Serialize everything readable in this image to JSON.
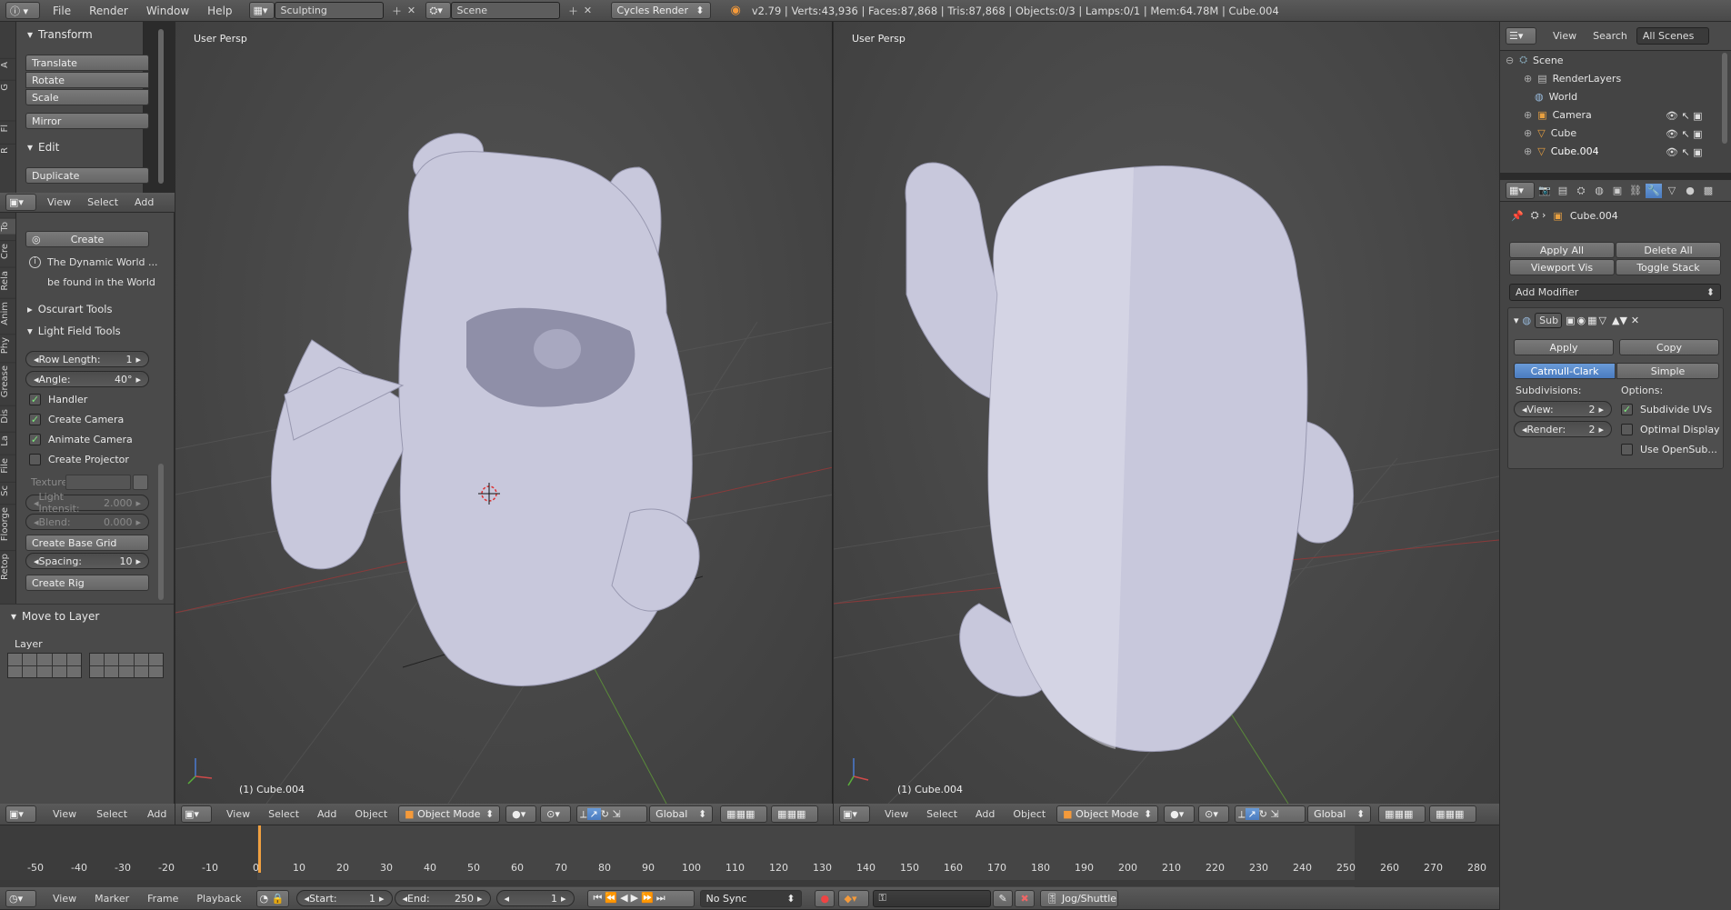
{
  "topbar": {
    "menus": [
      "File",
      "Render",
      "Window",
      "Help"
    ],
    "screen_layout": "Sculpting",
    "scene": "Scene",
    "render_engine": "Cycles Render",
    "stats": "v2.79 | Verts:43,936 | Faces:87,868 | Tris:87,868 | Objects:0/3 | Lamps:0/1 | Mem:64.78M | Cube.004"
  },
  "toolshelf_top": {
    "transform_title": "Transform",
    "transform_buttons": [
      "Translate",
      "Rotate",
      "Scale"
    ],
    "mirror": "Mirror",
    "edit_title": "Edit",
    "duplicate": "Duplicate",
    "tabs": [
      "A",
      "G",
      "Fl",
      "R"
    ],
    "header_menus": [
      "View",
      "Select",
      "Add"
    ]
  },
  "toolshelf_bottom": {
    "create": "Create",
    "info_line1": "The Dynamic World ...",
    "info_line2": "be found in the World",
    "oscurart": "Oscurart Tools",
    "lightfield": "Light Field Tools",
    "row_length_label": "Row Length:",
    "row_length_value": "1",
    "angle_label": "Angle:",
    "angle_value": "40°",
    "handler": "Handler",
    "create_camera": "Create Camera",
    "animate_camera": "Animate Camera",
    "create_projector": "Create Projector",
    "texture_label": "Texture",
    "light_intensity_label": "Light Intensit:",
    "light_intensity_value": "2.000",
    "blend_label": "Blend:",
    "blend_value": "0.000",
    "create_base_grid": "Create Base Grid",
    "spacing_label": "Spacing:",
    "spacing_value": "10",
    "create_rig": "Create Rig",
    "move_to_layer": "Move to Layer",
    "layer_label": "Layer",
    "tabs": [
      "To",
      "Cre",
      "Rela",
      "Anim",
      "Phy",
      "Grease",
      "Dis",
      "La",
      "File",
      "Sc",
      "Floorge",
      "Retop"
    ],
    "header_menus": [
      "View",
      "Select",
      "Add"
    ]
  },
  "viewport_left": {
    "label": "User Persp",
    "object_label": "(1) Cube.004",
    "menus": [
      "View",
      "Select",
      "Add",
      "Object"
    ],
    "mode": "Object Mode",
    "orientation": "Global"
  },
  "viewport_right": {
    "label": "User Persp",
    "object_label": "(1) Cube.004",
    "menus": [
      "View",
      "Select",
      "Add",
      "Object"
    ],
    "mode": "Object Mode",
    "orientation": "Global"
  },
  "timeline": {
    "ticks": [
      "-50",
      "-40",
      "-30",
      "-20",
      "-10",
      "0",
      "10",
      "20",
      "30",
      "40",
      "50",
      "60",
      "70",
      "80",
      "90",
      "100",
      "110",
      "120",
      "130",
      "140",
      "150",
      "160",
      "170",
      "180",
      "190",
      "200",
      "210",
      "220",
      "230",
      "240",
      "250",
      "260",
      "270",
      "280"
    ],
    "menus": [
      "View",
      "Marker",
      "Frame",
      "Playback"
    ],
    "start_label": "Start:",
    "start_value": "1",
    "end_label": "End:",
    "end_value": "250",
    "current_frame": "1",
    "sync": "No Sync",
    "jog": "Jog/Shuttle"
  },
  "outliner": {
    "menus": [
      "View",
      "Search"
    ],
    "filter": "All Scenes",
    "items": [
      "Scene",
      "RenderLayers",
      "World",
      "Camera",
      "Cube",
      "Cube.004"
    ]
  },
  "properties": {
    "object_name": "Cube.004",
    "apply_all": "Apply All",
    "delete_all": "Delete All",
    "viewport_vis": "Viewport Vis",
    "toggle_stack": "Toggle Stack",
    "add_modifier": "Add Modifier",
    "modifier_name": "Sub",
    "apply": "Apply",
    "copy": "Copy",
    "catmull": "Catmull-Clark",
    "simple": "Simple",
    "subdivisions": "Subdivisions:",
    "options": "Options:",
    "view_label": "View:",
    "view_value": "2",
    "render_label": "Render:",
    "render_value": "2",
    "subdivide_uvs": "Subdivide UVs",
    "optimal_display": "Optimal Display",
    "use_opensub": "Use OpenSub..."
  }
}
